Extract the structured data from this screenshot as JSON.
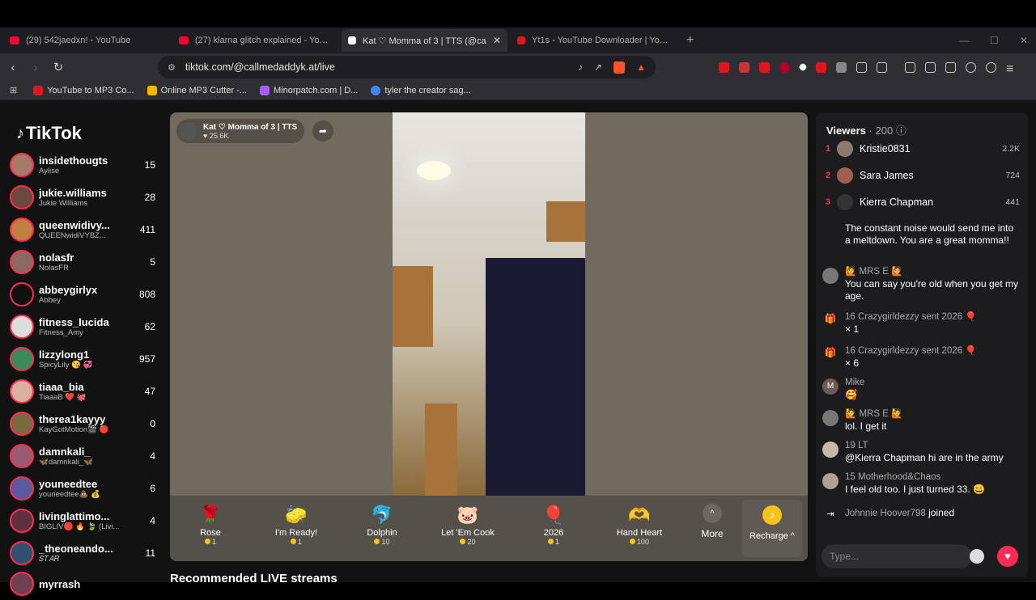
{
  "browser": {
    "tabs": [
      {
        "title": "(29) 542jaedxn! - YouTube",
        "color": "#ff0033"
      },
      {
        "title": "(27) klarna glitch explained - YouTube",
        "color": "#ff0033"
      },
      {
        "title": "Kat ♡ Momma of 3 | TTS (@ca",
        "color": "#ffffff"
      },
      {
        "title": "Yt1s - YouTube Downloader | YouTube",
        "color": "#e0161e"
      }
    ],
    "new_tab": "+",
    "address": "tiktok.com/@callmedaddyk.at/live",
    "bookmarks": [
      {
        "label": "YouTube to MP3 Co...",
        "color": "#e0161e"
      },
      {
        "label": "Online MP3 Cutter -...",
        "color": "#f5b400"
      },
      {
        "label": "Minorpatch.com | D...",
        "color": "#a45cff"
      },
      {
        "label": "tyler the creator sag...",
        "color": "#4285f4"
      }
    ]
  },
  "sidebar": {
    "logo": "TikTok",
    "accounts": [
      {
        "name": "insidethougts",
        "sub": "Aylise",
        "count": "15"
      },
      {
        "name": "jukie.williams",
        "sub": "Jukie Williams",
        "count": "28"
      },
      {
        "name": "queenwidivy...",
        "sub": "QUEENwidiVYBZ...",
        "count": "411"
      },
      {
        "name": "nolasfr",
        "sub": "NolasFR",
        "count": "5"
      },
      {
        "name": "abbeygirlyx",
        "sub": "Abbey",
        "count": "808"
      },
      {
        "name": "fitness_lucida",
        "sub": "Fitness_Amy",
        "count": "62"
      },
      {
        "name": "lizzylong1",
        "sub": "SpicyLily 😘 💞",
        "count": "957"
      },
      {
        "name": "tiaaa_bia",
        "sub": "TiaaaB ❤️ 🐙",
        "count": "47"
      },
      {
        "name": "therea1kayyy",
        "sub": "KayGotMotion🎬 🔴",
        "count": "0"
      },
      {
        "name": "damnkali_",
        "sub": "🦋damnkali_🦋",
        "count": "4"
      },
      {
        "name": "youneedtee",
        "sub": "youneedtee💩 💰",
        "count": "6"
      },
      {
        "name": "livinglattimo...",
        "sub": "BIGLIV🛑 🔥 🍃 (Livi...",
        "count": "4"
      },
      {
        "name": "_theoneando...",
        "sub": "𝑆𝑇𝐴𝑅",
        "count": "11"
      },
      {
        "name": "myrrash",
        "sub": "",
        "count": ""
      }
    ]
  },
  "stream": {
    "host_name": "Kat ♡ Momma of 3 | TTS",
    "likes": "♥ 25.6K",
    "gifts": [
      {
        "name": "Rose",
        "price": "1",
        "icon": "🌹"
      },
      {
        "name": "I'm Ready!",
        "price": "1",
        "icon": "🧽"
      },
      {
        "name": "Dolphin",
        "price": "10",
        "icon": "🐬"
      },
      {
        "name": "Let 'Em Cook",
        "price": "20",
        "icon": "🐷"
      },
      {
        "name": "2026",
        "price": "1",
        "icon": "🎈"
      },
      {
        "name": "Hand Heart",
        "price": "100",
        "icon": "🫶"
      }
    ],
    "more_label": "More",
    "recharge_label": "Recharge ^"
  },
  "recommended_heading": "Recommended LIVE streams",
  "chat": {
    "viewers_label": "Viewers",
    "viewers_count": "· 200",
    "top_viewers": [
      {
        "rank": "1",
        "name": "Kristie0831",
        "score": "2.2K"
      },
      {
        "rank": "2",
        "name": "Sara James",
        "score": "724"
      },
      {
        "rank": "3",
        "name": "Kierra Chapman",
        "score": "441"
      }
    ],
    "messages": [
      {
        "user": "",
        "text": "The constant noise would send me into a meltdown. You are a great momma!!"
      },
      {
        "user": "🙋 MRS E 🙋",
        "text": "You can say you're old when you get my age."
      },
      {
        "user": "16 Crazygirldezzy sent 2026 🎈",
        "text": "× 1"
      },
      {
        "user": "16 Crazygirldezzy sent 2026 🎈",
        "text": "× 6"
      },
      {
        "user": "Mike",
        "text": "🥰"
      },
      {
        "user": "🙋 MRS E 🙋",
        "text": "lol. I get it"
      },
      {
        "user": "19 LT",
        "text": "@Kierra Chapman hi are in the army"
      },
      {
        "user": "15 Motherhood&Chaos",
        "text": "I feel old too. I just turned 33. 😄"
      },
      {
        "user": "Johnnie Hoover798",
        "text": "joined"
      }
    ],
    "input_placeholder": "Type..."
  }
}
